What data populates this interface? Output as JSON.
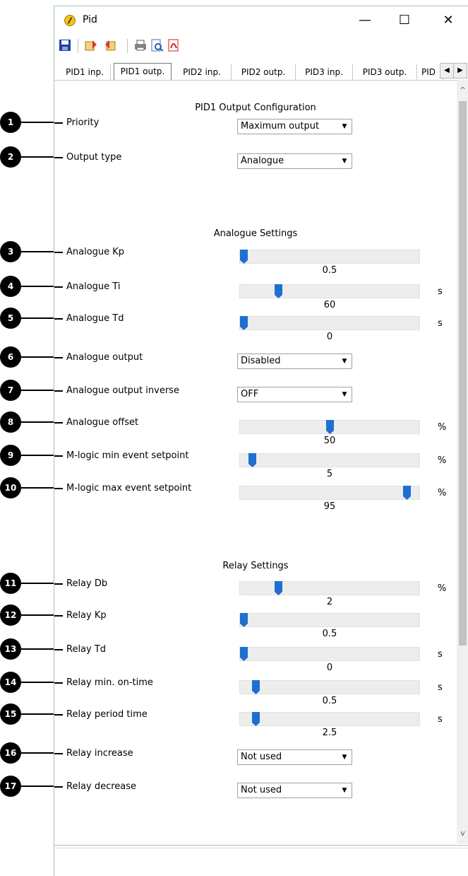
{
  "window": {
    "title": "Pid",
    "minimize": "—",
    "maximize": "☐",
    "close": "✕"
  },
  "toolbar": {
    "icons": [
      "save-icon",
      "write-settings-icon",
      "read-settings-icon",
      "print-icon",
      "print-preview-icon",
      "pdf-export-icon"
    ]
  },
  "tabs": [
    {
      "label": "PID1 inp.",
      "active": false
    },
    {
      "label": "PID1 outp.",
      "active": true
    },
    {
      "label": "PID2 inp.",
      "active": false
    },
    {
      "label": "PID2 outp.",
      "active": false
    },
    {
      "label": "PID3 inp.",
      "active": false
    },
    {
      "label": "PID3 outp.",
      "active": false
    },
    {
      "label": "PID",
      "active": false
    }
  ],
  "page": {
    "heading": "PID1 Output Configuration",
    "analogue_heading": "Analogue Settings",
    "relay_heading": "Relay Settings"
  },
  "fields": [
    {
      "n": "1",
      "label": "Priority",
      "type": "select",
      "value": "Maximum output"
    },
    {
      "n": "2",
      "label": "Output type",
      "type": "select",
      "value": "Analogue"
    },
    {
      "n": "3",
      "label": "Analogue Kp",
      "type": "slider",
      "value": "0.5",
      "pos": 0.0,
      "unit": ""
    },
    {
      "n": "4",
      "label": "Analogue Ti",
      "type": "slider",
      "value": "60",
      "pos": 0.2,
      "unit": "s"
    },
    {
      "n": "5",
      "label": "Analogue Td",
      "type": "slider",
      "value": "0",
      "pos": 0.0,
      "unit": "s"
    },
    {
      "n": "6",
      "label": "Analogue output",
      "type": "select",
      "value": "Disabled"
    },
    {
      "n": "7",
      "label": "Analogue output inverse",
      "type": "select",
      "value": "OFF"
    },
    {
      "n": "8",
      "label": "Analogue offset",
      "type": "slider",
      "value": "50",
      "pos": 0.5,
      "unit": "%"
    },
    {
      "n": "9",
      "label": "M-logic min event setpoint",
      "type": "slider",
      "value": "5",
      "pos": 0.05,
      "unit": "%"
    },
    {
      "n": "10",
      "label": "M-logic max event setpoint",
      "type": "slider",
      "value": "95",
      "pos": 0.95,
      "unit": "%"
    },
    {
      "n": "11",
      "label": "Relay Db",
      "type": "slider",
      "value": "2",
      "pos": 0.2,
      "unit": "%"
    },
    {
      "n": "12",
      "label": "Relay Kp",
      "type": "slider",
      "value": "0.5",
      "pos": 0.0,
      "unit": ""
    },
    {
      "n": "13",
      "label": "Relay Td",
      "type": "slider",
      "value": "0",
      "pos": 0.0,
      "unit": "s"
    },
    {
      "n": "14",
      "label": "Relay min. on-time",
      "type": "slider",
      "value": "0.5",
      "pos": 0.07,
      "unit": "s"
    },
    {
      "n": "15",
      "label": "Relay period time",
      "type": "slider",
      "value": "2.5",
      "pos": 0.07,
      "unit": "s"
    },
    {
      "n": "16",
      "label": "Relay increase",
      "type": "select",
      "value": "Not used"
    },
    {
      "n": "17",
      "label": "Relay decrease",
      "type": "select",
      "value": "Not used"
    }
  ]
}
